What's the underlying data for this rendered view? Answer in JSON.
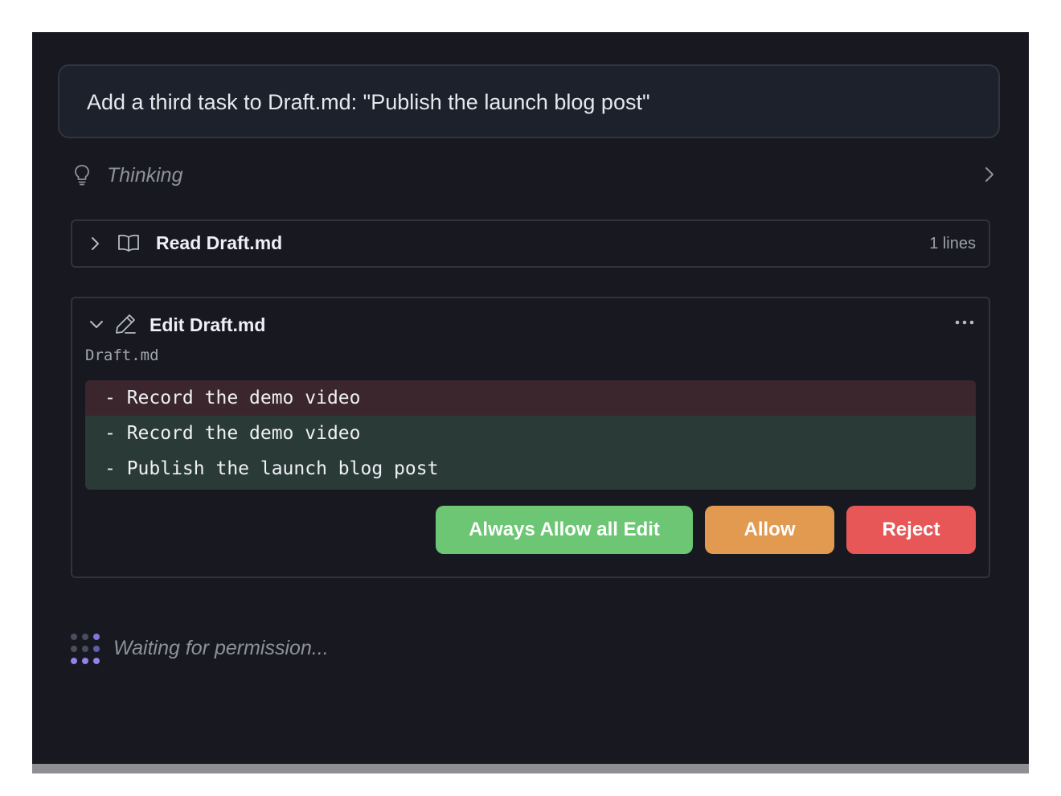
{
  "prompt": {
    "text": "Add a third task to Draft.md: \"Publish the launch blog post\""
  },
  "thinking": {
    "label": "Thinking",
    "icon": "lightbulb-icon",
    "expand_icon": "chevron-right-icon"
  },
  "read_tool": {
    "title": "Read Draft.md",
    "meta": "1 lines",
    "icon": "book-open-icon",
    "expand_icon": "chevron-right-icon"
  },
  "edit_tool": {
    "title": "Edit Draft.md",
    "file_label": "Draft.md",
    "icon": "pencil-icon",
    "collapse_icon": "chevron-down-icon",
    "menu_icon": "more-horizontal-icon",
    "diff": [
      {
        "type": "removed",
        "text": "- Record the demo video"
      },
      {
        "type": "added",
        "text": "- Record the demo video"
      },
      {
        "type": "added",
        "text": "- Publish the launch blog post"
      }
    ],
    "buttons": {
      "always_allow": "Always Allow all Edit",
      "allow": "Allow",
      "reject": "Reject"
    }
  },
  "status": {
    "text": "Waiting for permission...",
    "icon": "loading-dots-icon"
  },
  "colors": {
    "background": "#181920",
    "removed_line": "#3c262d",
    "added_line": "#2a3a36",
    "always_allow": "#6cc673",
    "allow": "#e19a50",
    "reject": "#e85758",
    "loader_active": "#8f84e8",
    "loader_inactive": "#4a4d5c"
  }
}
